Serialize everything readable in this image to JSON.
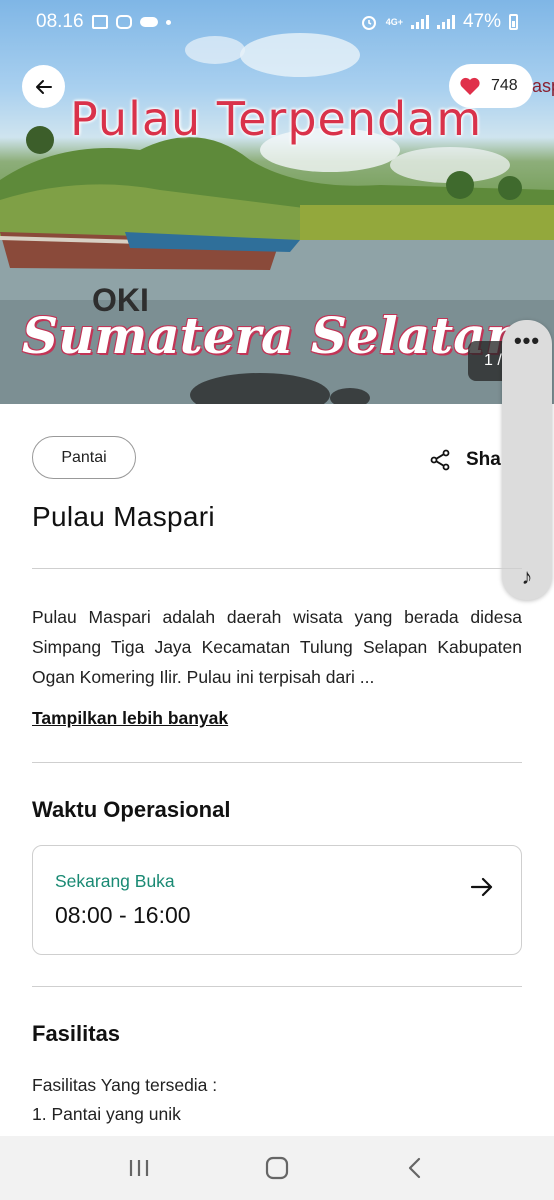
{
  "status_bar": {
    "time": "08.16",
    "network": "4G+",
    "battery": "47%"
  },
  "hero": {
    "overlay_title": "Pulau Terpendam",
    "overlay_region": "OKI",
    "overlay_province": "Sumatera Selatan",
    "overlay_corner": "asp",
    "like_count": "748",
    "image_counter": "1 /"
  },
  "detail": {
    "category": "Pantai",
    "share_label": "Sha",
    "title": "Pulau Maspari",
    "description": "Pulau Maspari adalah daerah wisata yang berada didesa Simpang Tiga Jaya Kecamatan Tulung Selapan Kabupaten Ogan Komering Ilir. Pulau ini terpisah dari ...",
    "show_more": "Tampilkan lebih banyak"
  },
  "hours": {
    "section_title": "Waktu Operasional",
    "status": "Sekarang Buka",
    "time_range": "08:00 - 16:00"
  },
  "facilities": {
    "section_title": "Fasilitas",
    "label": "Fasilitas Yang tersedia :",
    "items": [
      "1.  Pantai yang unik"
    ]
  },
  "side_panel": {
    "menu_glyph": "•••",
    "note_glyph": "♪"
  },
  "icons": {
    "back": "arrow-left-icon",
    "like": "heart-icon",
    "share": "share-icon",
    "arrow": "arrow-right-icon",
    "nav_recents": "recents-icon",
    "nav_home": "home-icon",
    "nav_back": "nav-back-icon"
  },
  "colors": {
    "accent_green": "#1a8a74",
    "heart_red": "#e0304a"
  }
}
